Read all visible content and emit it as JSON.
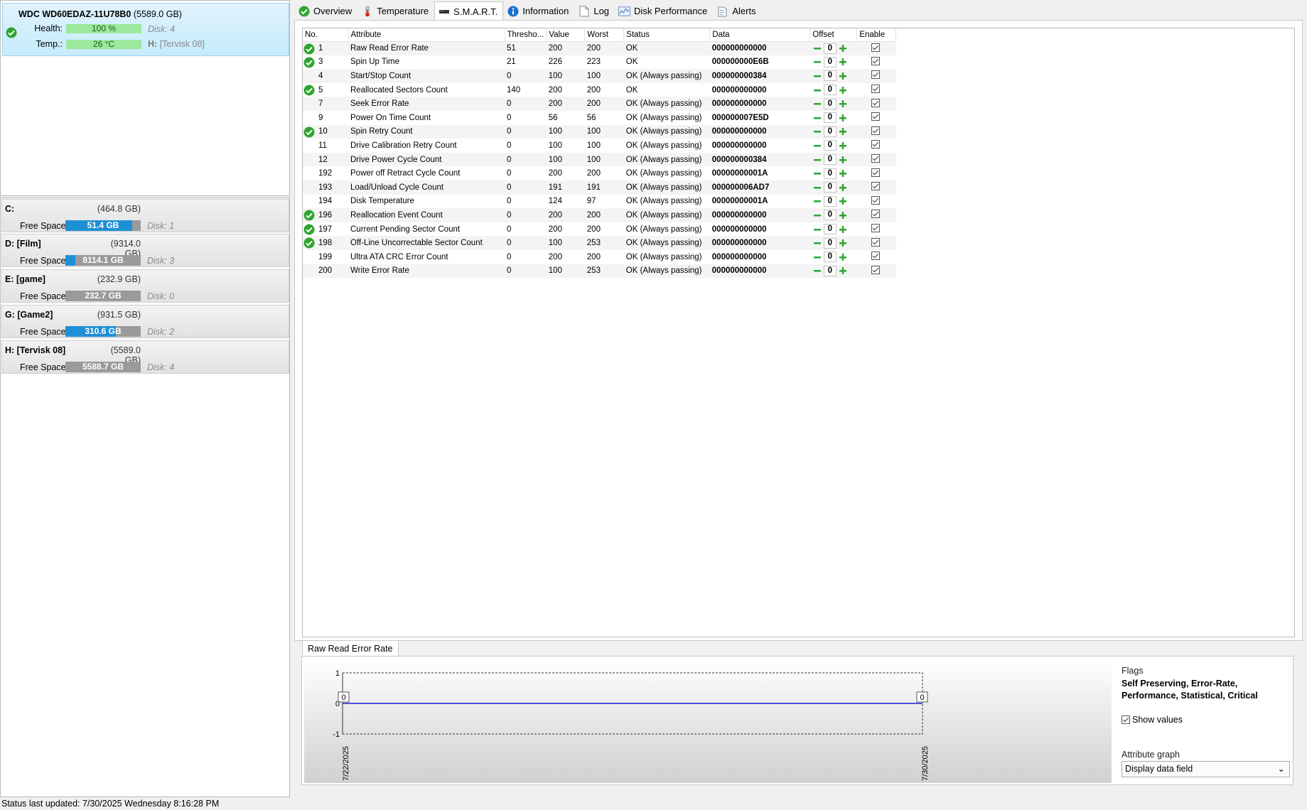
{
  "disk": {
    "name": "WDC WD60EDAZ-11U78B0",
    "size": "(5589.0 GB)",
    "health_label": "Health:",
    "health_value": "100 %",
    "health_pct": 100,
    "temp_label": "Temp.:",
    "temp_value": "26 °C",
    "temp_pct": 100,
    "disk_id": "Disk: 4",
    "volume_prefix": "H:",
    "volume_name": "[Tervisk 08]"
  },
  "volumes": [
    {
      "letter": "C:",
      "size": "(464.8 GB)",
      "free_label": "Free Space",
      "free": "51.4 GB",
      "used_pct": 89,
      "disk": "Disk: 1"
    },
    {
      "letter": "D: [Film]",
      "size": "(9314.0 GB)",
      "free_label": "Free Space",
      "free": "8114.1 GB",
      "used_pct": 13,
      "disk": "Disk: 3"
    },
    {
      "letter": "E: [game]",
      "size": "(232.9 GB)",
      "free_label": "Free Space",
      "free": "232.7 GB",
      "used_pct": 0,
      "disk": "Disk: 0"
    },
    {
      "letter": "G: [Game2]",
      "size": "(931.5 GB)",
      "free_label": "Free Space",
      "free": "310.6 GB",
      "used_pct": 67,
      "disk": "Disk: 2"
    },
    {
      "letter": "H: [Tervisk 08]",
      "size": "(5589.0 GB)",
      "free_label": "Free Space",
      "free": "5588.7 GB",
      "used_pct": 0,
      "disk": "Disk: 4"
    }
  ],
  "tabs": [
    {
      "label": "Overview",
      "icon": "check-icon"
    },
    {
      "label": "Temperature",
      "icon": "thermometer-icon"
    },
    {
      "label": "S.M.A.R.T.",
      "icon": "drive-icon",
      "active": true
    },
    {
      "label": "Information",
      "icon": "info-icon"
    },
    {
      "label": "Log",
      "icon": "document-icon"
    },
    {
      "label": "Disk Performance",
      "icon": "performance-chart-icon"
    },
    {
      "label": "Alerts",
      "icon": "alerts-icon"
    }
  ],
  "smart": {
    "columns": [
      "No.",
      "Attribute",
      "Thresho...",
      "Value",
      "Worst",
      "Status",
      "Data",
      "Offset",
      "Enable"
    ],
    "rows": [
      {
        "ok": true,
        "no": "1",
        "attr": "Raw Read Error Rate",
        "thr": "51",
        "val": "200",
        "worst": "200",
        "status": "OK",
        "data": "000000000000",
        "offset": "0"
      },
      {
        "ok": true,
        "no": "3",
        "attr": "Spin Up Time",
        "thr": "21",
        "val": "226",
        "worst": "223",
        "status": "OK",
        "data": "000000000E6B",
        "offset": "0"
      },
      {
        "ok": false,
        "no": "4",
        "attr": "Start/Stop Count",
        "thr": "0",
        "val": "100",
        "worst": "100",
        "status": "OK (Always passing)",
        "data": "000000000384",
        "offset": "0"
      },
      {
        "ok": true,
        "no": "5",
        "attr": "Reallocated Sectors Count",
        "thr": "140",
        "val": "200",
        "worst": "200",
        "status": "OK",
        "data": "000000000000",
        "offset": "0"
      },
      {
        "ok": false,
        "no": "7",
        "attr": "Seek Error Rate",
        "thr": "0",
        "val": "200",
        "worst": "200",
        "status": "OK (Always passing)",
        "data": "000000000000",
        "offset": "0"
      },
      {
        "ok": false,
        "no": "9",
        "attr": "Power On Time Count",
        "thr": "0",
        "val": "56",
        "worst": "56",
        "status": "OK (Always passing)",
        "data": "000000007E5D",
        "offset": "0"
      },
      {
        "ok": true,
        "no": "10",
        "attr": "Spin Retry Count",
        "thr": "0",
        "val": "100",
        "worst": "100",
        "status": "OK (Always passing)",
        "data": "000000000000",
        "offset": "0"
      },
      {
        "ok": false,
        "no": "11",
        "attr": "Drive Calibration Retry Count",
        "thr": "0",
        "val": "100",
        "worst": "100",
        "status": "OK (Always passing)",
        "data": "000000000000",
        "offset": "0"
      },
      {
        "ok": false,
        "no": "12",
        "attr": "Drive Power Cycle Count",
        "thr": "0",
        "val": "100",
        "worst": "100",
        "status": "OK (Always passing)",
        "data": "000000000384",
        "offset": "0"
      },
      {
        "ok": false,
        "no": "192",
        "attr": "Power off Retract Cycle Count",
        "thr": "0",
        "val": "200",
        "worst": "200",
        "status": "OK (Always passing)",
        "data": "00000000001A",
        "offset": "0"
      },
      {
        "ok": false,
        "no": "193",
        "attr": "Load/Unload Cycle Count",
        "thr": "0",
        "val": "191",
        "worst": "191",
        "status": "OK (Always passing)",
        "data": "000000006AD7",
        "offset": "0"
      },
      {
        "ok": false,
        "no": "194",
        "attr": "Disk Temperature",
        "thr": "0",
        "val": "124",
        "worst": "97",
        "status": "OK (Always passing)",
        "data": "00000000001A",
        "offset": "0"
      },
      {
        "ok": true,
        "no": "196",
        "attr": "Reallocation Event Count",
        "thr": "0",
        "val": "200",
        "worst": "200",
        "status": "OK (Always passing)",
        "data": "000000000000",
        "offset": "0"
      },
      {
        "ok": true,
        "no": "197",
        "attr": "Current Pending Sector Count",
        "thr": "0",
        "val": "200",
        "worst": "200",
        "status": "OK (Always passing)",
        "data": "000000000000",
        "offset": "0"
      },
      {
        "ok": true,
        "no": "198",
        "attr": "Off-Line Uncorrectable Sector Count",
        "thr": "0",
        "val": "100",
        "worst": "253",
        "status": "OK (Always passing)",
        "data": "000000000000",
        "offset": "0"
      },
      {
        "ok": false,
        "no": "199",
        "attr": "Ultra ATA CRC Error Count",
        "thr": "0",
        "val": "200",
        "worst": "200",
        "status": "OK (Always passing)",
        "data": "000000000000",
        "offset": "0"
      },
      {
        "ok": false,
        "no": "200",
        "attr": "Write Error Rate",
        "thr": "0",
        "val": "100",
        "worst": "253",
        "status": "OK (Always passing)",
        "data": "000000000000",
        "offset": "0"
      }
    ]
  },
  "graph": {
    "tab_label": "Raw Read Error Rate",
    "y_ticks": [
      "1",
      "0",
      "-1"
    ],
    "start_value_label": "0",
    "end_value_label": "0",
    "x_start": "7/22/2025",
    "x_end": "7/30/2025",
    "flags_title": "Flags",
    "flags_value": "Self Preserving, Error-Rate, Performance, Statistical, Critical",
    "show_values_label": "Show values",
    "attribute_graph_label": "Attribute graph",
    "attribute_graph_value": "Display data field",
    "line_color": "#1c1cd8"
  },
  "status_bar": "Status last updated: 7/30/2025 Wednesday 8:16:28 PM",
  "colors": {
    "ok_green": "#2fa52f",
    "bar_blue": "#1e90d6",
    "selected_card": "#c6ebfb"
  }
}
